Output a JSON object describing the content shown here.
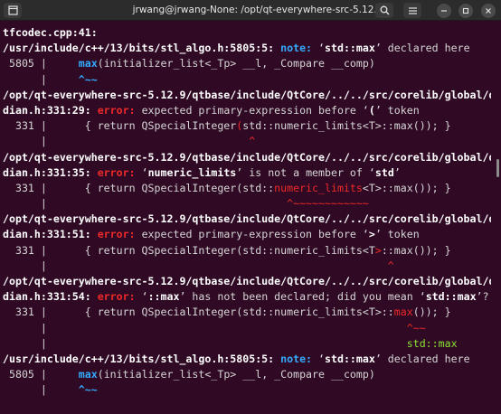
{
  "window": {
    "title": "jrwang@jrwang-None: /opt/qt-everywhere-src-5.12.9"
  },
  "lines": [
    [
      {
        "t": "tfcodec.cpp:41:",
        "c": "b"
      }
    ],
    [
      {
        "t": "/usr/include/c++/13/bits/stl_algo.h:5805:5: ",
        "c": "b"
      },
      {
        "t": "note: ",
        "c": "note"
      },
      {
        "t": "‘",
        "c": "w"
      },
      {
        "t": "std::max",
        "c": "b"
      },
      {
        "t": "’ declared here",
        "c": "w"
      }
    ],
    [
      {
        "t": " 5805 |     ",
        "c": "w"
      },
      {
        "t": "max",
        "c": "note"
      },
      {
        "t": "(initializer_list<_Tp> __l, _Compare __comp)",
        "c": "w"
      }
    ],
    [
      {
        "t": "      |     ",
        "c": "w"
      },
      {
        "t": "^~~",
        "c": "note"
      }
    ],
    [
      {
        "t": "/opt/qt-everywhere-src-5.12.9/qtbase/include/QtCore/../../src/corelib/global/qen",
        "c": "b"
      }
    ],
    [
      {
        "t": "dian.h:331:29: ",
        "c": "b"
      },
      {
        "t": "error: ",
        "c": "err"
      },
      {
        "t": "expected primary-expression before ‘",
        "c": "w"
      },
      {
        "t": "(",
        "c": "b"
      },
      {
        "t": "’ token",
        "c": "w"
      }
    ],
    [
      {
        "t": "  331 |      { return QSpecialInteger",
        "c": "w"
      },
      {
        "t": "(",
        "c": "red"
      },
      {
        "t": "std::numeric_limits<T>::max()); }",
        "c": "w"
      }
    ],
    [
      {
        "t": "      |                                ",
        "c": "w"
      },
      {
        "t": "^",
        "c": "car"
      }
    ],
    [
      {
        "t": "/opt/qt-everywhere-src-5.12.9/qtbase/include/QtCore/../../src/corelib/global/qen",
        "c": "b"
      }
    ],
    [
      {
        "t": "dian.h:331:35: ",
        "c": "b"
      },
      {
        "t": "error: ",
        "c": "err"
      },
      {
        "t": "‘",
        "c": "w"
      },
      {
        "t": "numeric_limits",
        "c": "b"
      },
      {
        "t": "’ is not a member of ‘",
        "c": "w"
      },
      {
        "t": "std",
        "c": "b"
      },
      {
        "t": "’",
        "c": "w"
      }
    ],
    [
      {
        "t": "  331 |      { return QSpecialInteger(std::",
        "c": "w"
      },
      {
        "t": "numeric_limits",
        "c": "red"
      },
      {
        "t": "<T>::max()); }",
        "c": "w"
      }
    ],
    [
      {
        "t": "      |                                      ",
        "c": "w"
      },
      {
        "t": "^~~~~~~~~~~~~",
        "c": "car"
      }
    ],
    [
      {
        "t": "/opt/qt-everywhere-src-5.12.9/qtbase/include/QtCore/../../src/corelib/global/qen",
        "c": "b"
      }
    ],
    [
      {
        "t": "dian.h:331:51: ",
        "c": "b"
      },
      {
        "t": "error: ",
        "c": "err"
      },
      {
        "t": "expected primary-expression before ‘",
        "c": "w"
      },
      {
        "t": ">",
        "c": "b"
      },
      {
        "t": "’ token",
        "c": "w"
      }
    ],
    [
      {
        "t": "  331 |      { return QSpecialInteger(std::numeric_limits<T",
        "c": "w"
      },
      {
        "t": ">",
        "c": "red"
      },
      {
        "t": "::max()); }",
        "c": "w"
      }
    ],
    [
      {
        "t": "      |                                                      ",
        "c": "w"
      },
      {
        "t": "^",
        "c": "car"
      }
    ],
    [
      {
        "t": "/opt/qt-everywhere-src-5.12.9/qtbase/include/QtCore/../../src/corelib/global/qen",
        "c": "b"
      }
    ],
    [
      {
        "t": "dian.h:331:54: ",
        "c": "b"
      },
      {
        "t": "error: ",
        "c": "err"
      },
      {
        "t": "‘",
        "c": "w"
      },
      {
        "t": "::max",
        "c": "b"
      },
      {
        "t": "’ has not been declared; did you mean ‘",
        "c": "w"
      },
      {
        "t": "std::max",
        "c": "b"
      },
      {
        "t": "’?",
        "c": "w"
      }
    ],
    [
      {
        "t": "  331 |      { return QSpecialInteger(std::numeric_limits<T>::",
        "c": "w"
      },
      {
        "t": "max",
        "c": "red"
      },
      {
        "t": "()); }",
        "c": "w"
      }
    ],
    [
      {
        "t": "      |                                                         ",
        "c": "w"
      },
      {
        "t": "^~~",
        "c": "car"
      }
    ],
    [
      {
        "t": "      |                                                         ",
        "c": "w"
      },
      {
        "t": "std::max",
        "c": "grn"
      }
    ],
    [
      {
        "t": "/usr/include/c++/13/bits/stl_algo.h:5805:5: ",
        "c": "b"
      },
      {
        "t": "note: ",
        "c": "note"
      },
      {
        "t": "‘",
        "c": "w"
      },
      {
        "t": "std::max",
        "c": "b"
      },
      {
        "t": "’ declared here",
        "c": "w"
      }
    ],
    [
      {
        "t": " 5805 |     ",
        "c": "w"
      },
      {
        "t": "max",
        "c": "note"
      },
      {
        "t": "(initializer_list<_Tp> __l, _Compare __comp)",
        "c": "w"
      }
    ],
    [
      {
        "t": "      |     ",
        "c": "w"
      },
      {
        "t": "^~~",
        "c": "note"
      }
    ]
  ],
  "icons": {
    "new_tab": "new-tab-icon",
    "search": "search-icon",
    "menu": "hamburger-menu-icon",
    "minimize": "minimize-icon",
    "maximize": "maximize-icon",
    "close": "close-icon"
  },
  "colors": {
    "background": "#300a24",
    "error": "#ef2929",
    "note": "#34aaff",
    "fixit": "#8ae234"
  }
}
